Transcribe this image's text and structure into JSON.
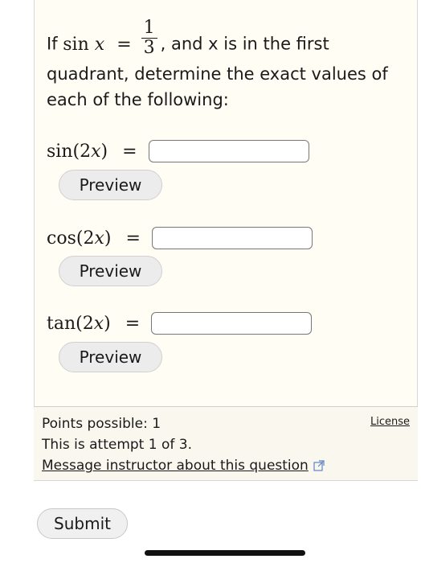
{
  "problem": {
    "prefix": "If ",
    "func": "sin",
    "var": "x",
    "eq": "=",
    "frac_num": "1",
    "frac_den": "3",
    "after_frac": ", and x is in the first",
    "rest": "quadrant, determine the exact values of each of the following:"
  },
  "questions": [
    {
      "func": "sin",
      "arg_open": "(2",
      "arg_var": "x",
      "arg_close": ")",
      "eq": "=",
      "answer": "",
      "preview_label": "Preview"
    },
    {
      "func": "cos",
      "arg_open": "(2",
      "arg_var": "x",
      "arg_close": ")",
      "eq": "=",
      "answer": "",
      "preview_label": "Preview"
    },
    {
      "func": "tan",
      "arg_open": "(2",
      "arg_var": "x",
      "arg_close": ")",
      "eq": "=",
      "answer": "",
      "preview_label": "Preview"
    }
  ],
  "info": {
    "points": "Points possible: 1",
    "attempt": "This is attempt 1 of 3.",
    "message_link": "Message instructor about this question",
    "license": "License"
  },
  "submit_label": "Submit",
  "colors": {
    "card_bg": "#fffdf4",
    "info_bg": "#faf7ee",
    "button_bg": "#ececec",
    "border": "#777777"
  }
}
